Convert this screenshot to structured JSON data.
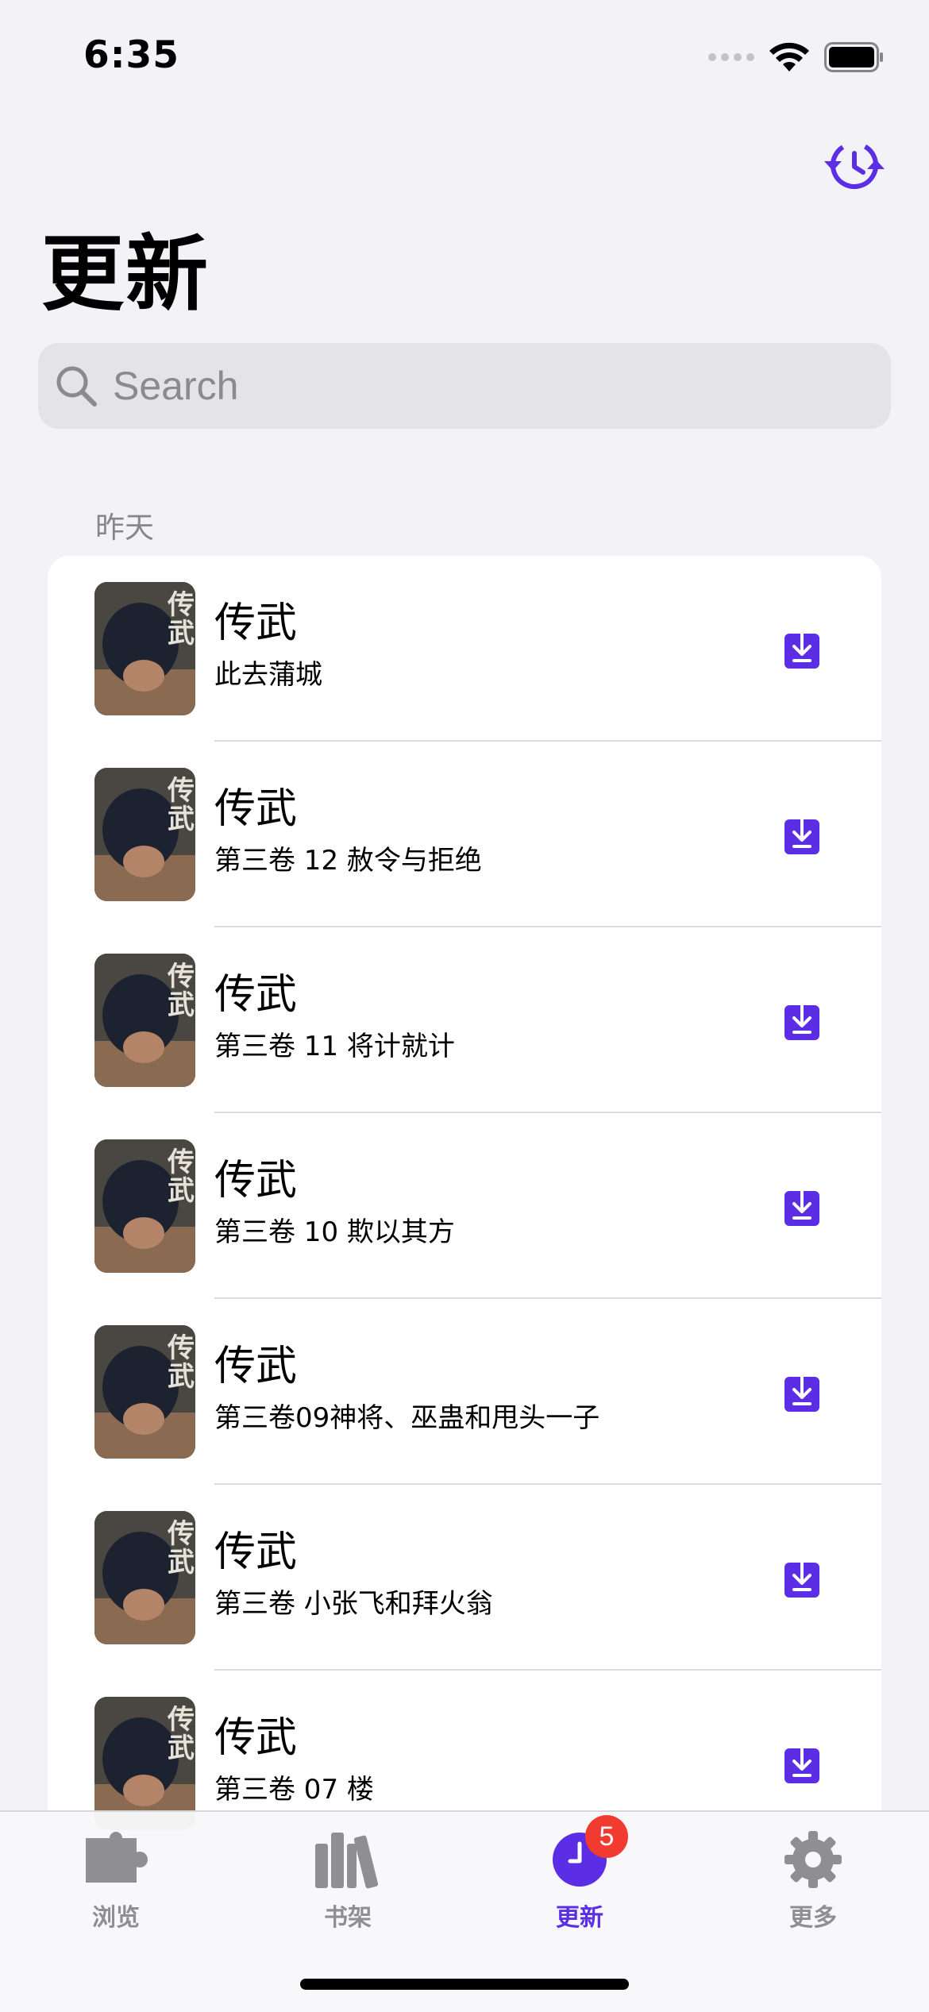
{
  "status_bar": {
    "time": "6:35"
  },
  "header": {
    "title": "更新",
    "history_icon": "history-refresh-icon"
  },
  "search": {
    "placeholder": "Search",
    "value": ""
  },
  "section": {
    "label": "昨天",
    "items": [
      {
        "title": "传武",
        "subtitle": "此去蒲城"
      },
      {
        "title": "传武",
        "subtitle": "第三卷 12 赦令与拒绝"
      },
      {
        "title": "传武",
        "subtitle": "第三卷 11 将计就计"
      },
      {
        "title": "传武",
        "subtitle": "第三卷 10 欺以其方"
      },
      {
        "title": "传武",
        "subtitle": "第三卷09神将、巫蛊和甩头一子"
      },
      {
        "title": "传武",
        "subtitle": "第三卷 小张飞和拜火翁"
      },
      {
        "title": "传武",
        "subtitle": "第三卷 07 楼"
      }
    ]
  },
  "tabs": [
    {
      "label": "浏览",
      "icon": "puzzle-icon",
      "active": false
    },
    {
      "label": "书架",
      "icon": "books-icon",
      "active": false
    },
    {
      "label": "更新",
      "icon": "clock-icon",
      "active": true,
      "badge": "5"
    },
    {
      "label": "更多",
      "icon": "gear-icon",
      "active": false
    }
  ],
  "colors": {
    "accent": "#5b2ee6",
    "badge": "#f23b30",
    "background": "#f2f2f7"
  }
}
